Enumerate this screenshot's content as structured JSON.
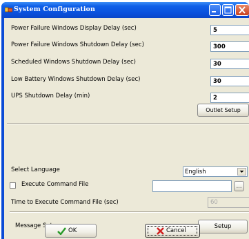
{
  "window": {
    "title": "System Configuration"
  },
  "delays": [
    {
      "label": "Power Failure Windows Display Delay (sec)",
      "value": "5"
    },
    {
      "label": "Power Failure Windows Shutdown Delay (sec)",
      "value": "300"
    },
    {
      "label": "Scheduled Windows Shutdown Delay (sec)",
      "value": "30"
    },
    {
      "label": "Low Battery Windows Shutdown Delay (sec)",
      "value": "30"
    },
    {
      "label": "UPS Shutdown Delay (min)",
      "value": "2"
    }
  ],
  "outlet_setup_label": "Outlet Setup",
  "language": {
    "label": "Select Language",
    "selected": "English"
  },
  "execute_command": {
    "label": "Execute Command File",
    "checked": false,
    "path": "",
    "browse_label": "...",
    "time_label": "Time to Execute Command File (sec)",
    "time_value": "60"
  },
  "message": {
    "label": "Message Setup",
    "button_label": "Setup"
  },
  "footer": {
    "ok_label": "OK",
    "cancel_label": "Cancel"
  },
  "colors": {
    "titlebar": "#0a50dc",
    "dialog_bg": "#ece9d8",
    "ok_check": "#2a9a2a",
    "cancel_x": "#d02020"
  },
  "icons": {
    "app": "app-icon",
    "minimize": "minimize-icon",
    "maximize": "maximize-icon",
    "close": "close-icon",
    "ok": "checkmark-icon",
    "cancel": "x-icon",
    "dropdown": "chevron-down-icon"
  }
}
